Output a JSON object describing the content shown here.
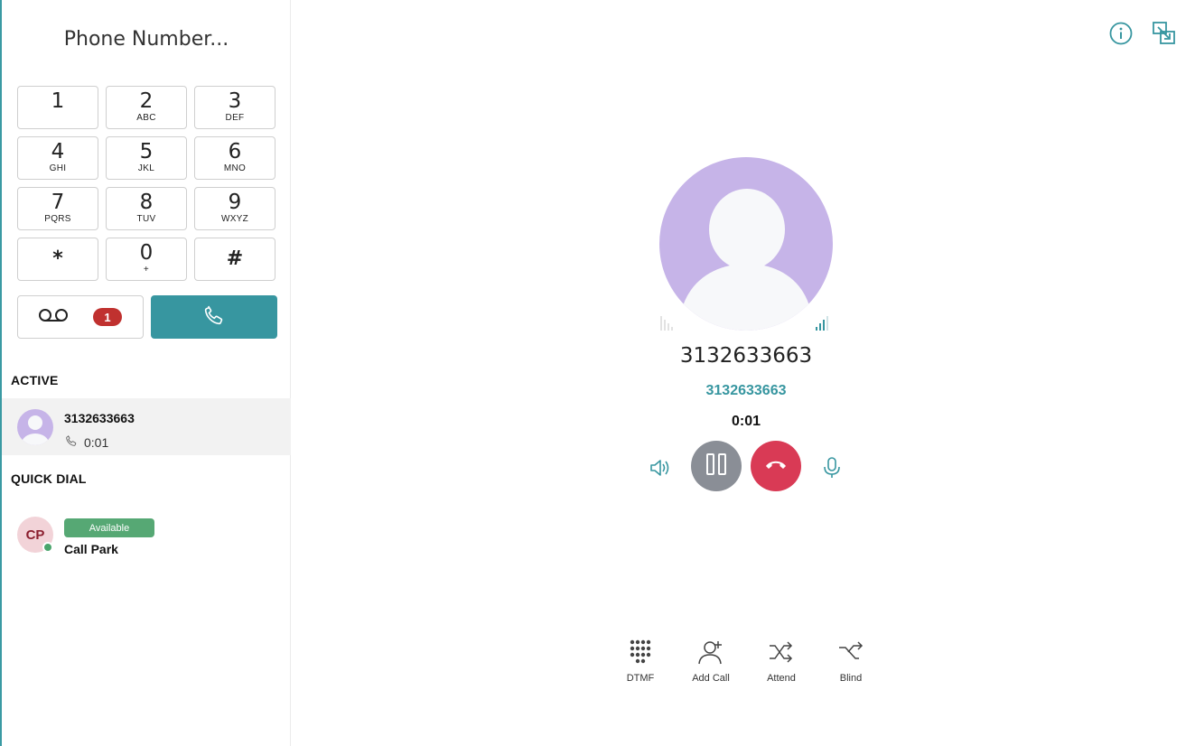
{
  "dialer": {
    "placeholder": "Phone Number...",
    "keys": [
      {
        "digit": "1",
        "letters": ""
      },
      {
        "digit": "2",
        "letters": "ABC"
      },
      {
        "digit": "3",
        "letters": "DEF"
      },
      {
        "digit": "4",
        "letters": "GHI"
      },
      {
        "digit": "5",
        "letters": "JKL"
      },
      {
        "digit": "6",
        "letters": "MNO"
      },
      {
        "digit": "7",
        "letters": "PQRS"
      },
      {
        "digit": "8",
        "letters": "TUV"
      },
      {
        "digit": "9",
        "letters": "WXYZ"
      },
      {
        "digit": "*",
        "letters": ""
      },
      {
        "digit": "0",
        "letters": "+"
      },
      {
        "digit": "#",
        "letters": ""
      }
    ],
    "voicemail_count": "1",
    "voicemail_icon": "voicemail-icon",
    "call_icon": "phone-icon"
  },
  "active": {
    "title": "ACTIVE",
    "call": {
      "number": "3132633663",
      "duration": "0:01"
    }
  },
  "quick_dial": {
    "title": "QUICK DIAL",
    "contact": {
      "initials": "CP",
      "status": "Available",
      "name": "Call Park",
      "status_color": "#56a874"
    }
  },
  "call": {
    "number": "3132633663",
    "subtitle": "3132633663",
    "timer": "0:01"
  },
  "actions": [
    {
      "label": "DTMF",
      "icon": "dialpad-icon"
    },
    {
      "label": "Add Call",
      "icon": "add-call-icon"
    },
    {
      "label": "Attend",
      "icon": "attended-transfer-icon"
    },
    {
      "label": "Blind",
      "icon": "blind-transfer-icon"
    }
  ],
  "colors": {
    "accent": "#3796a0",
    "hangup": "#d93a55",
    "hold": "#8a8e96",
    "avatar": "#c6b4e8",
    "badge": "#c0312f"
  }
}
